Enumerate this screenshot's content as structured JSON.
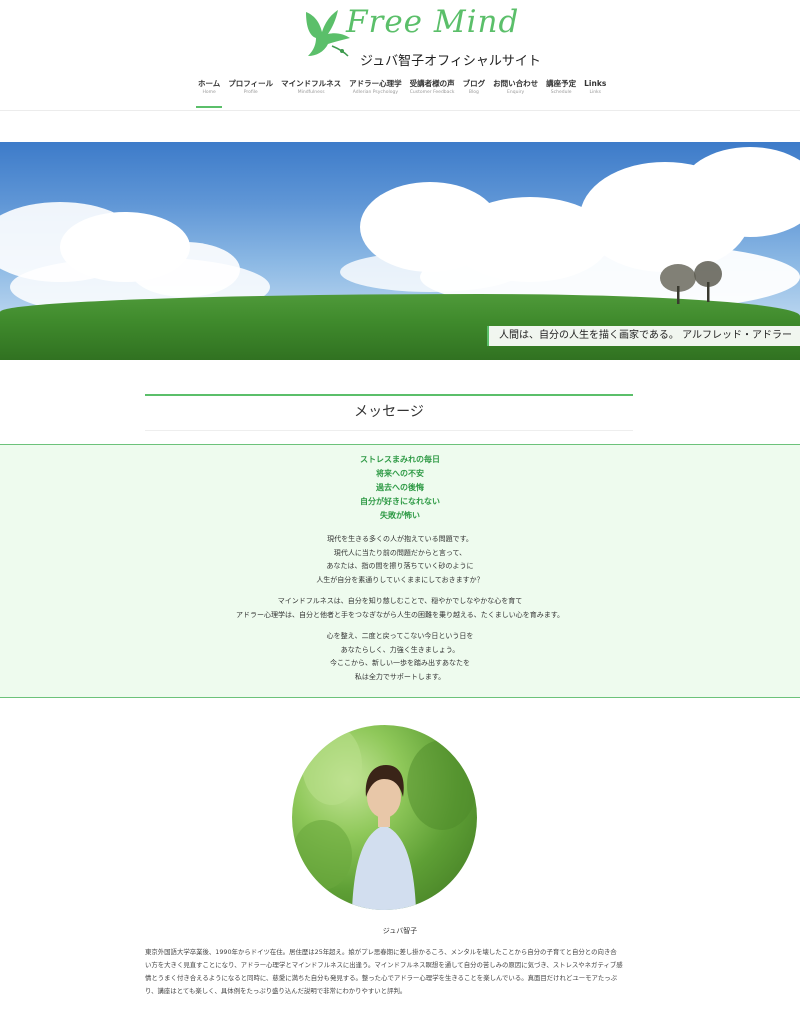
{
  "header": {
    "logo_text": "Free Mind",
    "logo_subtitle": "ジュバ智子オフィシャルサイト"
  },
  "nav": [
    {
      "label": "ホーム",
      "sub": "Home"
    },
    {
      "label": "プロフィール",
      "sub": "Profile"
    },
    {
      "label": "マインドフルネス",
      "sub": "Mindfulness"
    },
    {
      "label": "アドラー心理学",
      "sub": "Adlerian Psychology"
    },
    {
      "label": "受講者様の声",
      "sub": "Customer Feedback"
    },
    {
      "label": "ブログ",
      "sub": "Blog"
    },
    {
      "label": "お問い合わせ",
      "sub": "Enquiry"
    },
    {
      "label": "講座予定",
      "sub": "Schedule"
    },
    {
      "label": "Links",
      "sub": "Links"
    }
  ],
  "hero": {
    "quote": "人間は、自分の人生を描く画家である。 アルフレッド・アドラー"
  },
  "message": {
    "title": "メッセージ",
    "highlights": [
      "ストレスまみれの毎日",
      "将来への不安",
      "過去への後悔",
      "自分が好きになれない",
      "失敗が怖い"
    ],
    "para1": [
      "現代を生きる多くの人が抱えている問題です。",
      "現代人に当たり前の問題だからと言って、",
      "あなたは、指の間を擦り落ちていく砂のように",
      "人生が自分を素通りしていくままにしておきますか？"
    ],
    "para2": [
      "マインドフルネスは、自分を知り慈しむことで、穏やかでしなやかな心を育て",
      "アドラー心理学は、自分と他者と手をつなぎながら人生の困難を乗り越える、たくましい心を育みます。"
    ],
    "para3": [
      "心を整え、二度と戻ってこない今日という日を",
      "あなたらしく、力強く生きましょう。",
      "今ここから、新しい一歩を踏み出すあなたを",
      "私は全力でサポートします。"
    ]
  },
  "profile": {
    "name": "ジュバ智子",
    "bio": [
      "東京外国語大学卒業後、1990年からドイツ在住。居住歴は25年超え。娘がプレ思春期に差し掛かるころ、メンタルを壊したことから自分の子育てと自分との向き合",
      "い方を大きく見直すことになり、アドラー心理学とマインドフルネスに出逢う。マインドフルネス瞑想を通して自分の苦しみの原因に気づき、ストレスやネガティブ感",
      "情とうまく付き合えるようになると同時に、慈愛に満ちた自分も発見する。整った心でアドラー心理学を生きることを楽しんでいる。真面目だけれどユーモアたっぷ",
      "り、講座はとても楽しく、具体例をたっぷり盛り込んだ説明で非常にわかりやすいと評判。"
    ]
  },
  "colors": {
    "accent": "#5bbf6a",
    "message_bg": "#eefbee",
    "highlight_text": "#2e9a45"
  }
}
